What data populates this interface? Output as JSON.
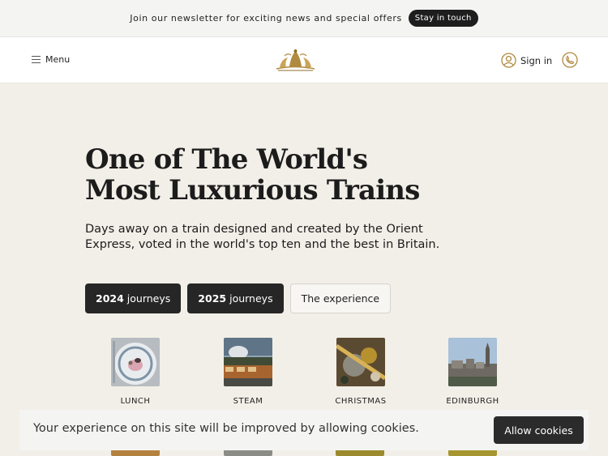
{
  "announcement": {
    "text": "Join our newsletter for exciting news and special offers",
    "button_label": "Stay in touch"
  },
  "header": {
    "menu_label": "Menu",
    "menu_icon": "hamburger-icon",
    "logo": "britannic-explorer-crest-logo",
    "signin_label": "Sign in",
    "signin_icon": "user-icon",
    "phone_icon": "phone-icon",
    "accent_color": "#b08a3e"
  },
  "hero": {
    "title_line1": "One of The World's",
    "title_line2": "Most Luxurious Trains",
    "subtitle": "Days away on a train designed and created by the Orient Express, voted in the world's top ten and the best in Britain."
  },
  "tabs": [
    {
      "year": "2024",
      "label": "journeys"
    },
    {
      "year": "2025",
      "label": "journeys"
    },
    {
      "label": "The experience"
    }
  ],
  "categories": [
    {
      "label": "LUNCH",
      "image": "plated-lunch-photo"
    },
    {
      "label": "STEAM",
      "image": "steam-train-photo"
    },
    {
      "label": "CHRISTMAS",
      "image": "christmas-decor-photo"
    },
    {
      "label": "EDINBURGH",
      "image": "edinburgh-skyline-photo"
    }
  ],
  "cookie": {
    "text": "Your experience on this site will be improved by allowing cookies.",
    "button_label": "Allow cookies"
  }
}
